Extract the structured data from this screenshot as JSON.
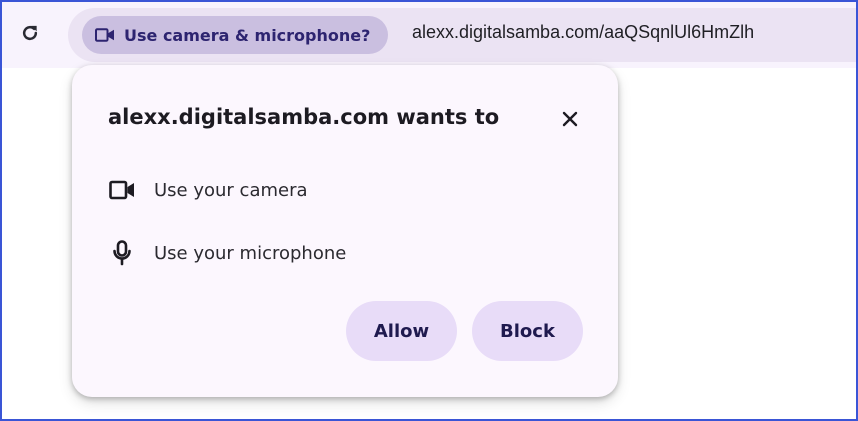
{
  "toolbar": {
    "reload_icon": "reload-icon",
    "permission_chip": {
      "label": "Use camera & microphone?",
      "icon": "camera-icon"
    },
    "url": "alexx.digitalsamba.com/aaQSqnlUl6HmZlh"
  },
  "popup": {
    "title": "alexx.digitalsamba.com wants to",
    "close_icon": "close-icon",
    "permissions": [
      {
        "icon": "camera-icon",
        "label": "Use your camera"
      },
      {
        "icon": "microphone-icon",
        "label": "Use your microphone"
      }
    ],
    "allow_label": "Allow",
    "block_label": "Block"
  },
  "colors": {
    "frame_border": "#3a55d6",
    "toolbar_bg": "#f8f3fd",
    "address_bar_bg": "#ebe3f3",
    "chip_bg": "#cabfe0",
    "chip_text": "#2d2470",
    "popup_bg": "#fcf7fe",
    "button_bg": "#e8dcf8",
    "button_text": "#1f1a4f"
  }
}
